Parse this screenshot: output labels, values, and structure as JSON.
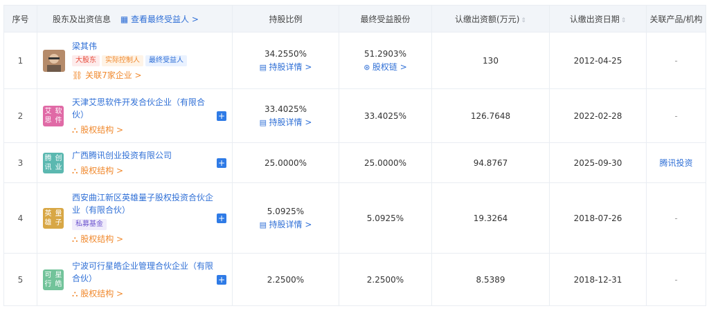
{
  "header": {
    "idx": "序号",
    "shareholder": "股东及出资信息",
    "beneficiary_link": "查看最终受益人 >",
    "ratio": "持股比例",
    "final_share": "最终受益股份",
    "amount": "认缴出资额(万元)",
    "date": "认缴出资日期",
    "related": "关联产品/机构"
  },
  "rows": [
    {
      "idx": "1",
      "name": "梁其伟",
      "tags": [
        "大股东",
        "实际控制人",
        "最终受益人"
      ],
      "sub_link": "关联7家企业 >",
      "ratio": "34.2550%",
      "ratio_link": "持股详情 >",
      "final_share": "51.2903%",
      "final_link": "股权链 >",
      "amount": "130",
      "date": "2012-04-25",
      "related": "-"
    },
    {
      "idx": "2",
      "logo": "艾思软件",
      "logo_color": "#e06aa6",
      "name": "天津艾思软件开发合伙企业（有限合伙）",
      "sub_link": "股权结构 >",
      "ratio": "33.4025%",
      "ratio_link": "持股详情 >",
      "final_share": "33.4025%",
      "amount": "126.7648",
      "date": "2022-02-28",
      "related": "-"
    },
    {
      "idx": "3",
      "logo": "腾讯创业",
      "logo_color": "#5bb8b0",
      "name": "广西腾讯创业投资有限公司",
      "sub_link": "股权结构 >",
      "ratio": "25.0000%",
      "final_share": "25.0000%",
      "amount": "94.8767",
      "date": "2025-09-30",
      "related": "腾讯投资"
    },
    {
      "idx": "4",
      "logo": "英雄量子",
      "logo_color": "#d8a745",
      "name": "西安曲江新区英雄量子股权投资合伙企业（有限合伙）",
      "tags": [
        "私募基金"
      ],
      "sub_link": "股权结构 >",
      "ratio": "5.0925%",
      "ratio_link": "持股详情 >",
      "final_share": "5.0925%",
      "amount": "19.3264",
      "date": "2018-07-26",
      "related": "-"
    },
    {
      "idx": "5",
      "logo": "可行星皓",
      "logo_color": "#72c39a",
      "name": "宁波可行星皓企业管理合伙企业（有限合伙）",
      "sub_link": "股权结构 >",
      "ratio": "2.2500%",
      "final_share": "2.2500%",
      "amount": "8.5389",
      "date": "2018-12-31",
      "related": "-"
    }
  ]
}
